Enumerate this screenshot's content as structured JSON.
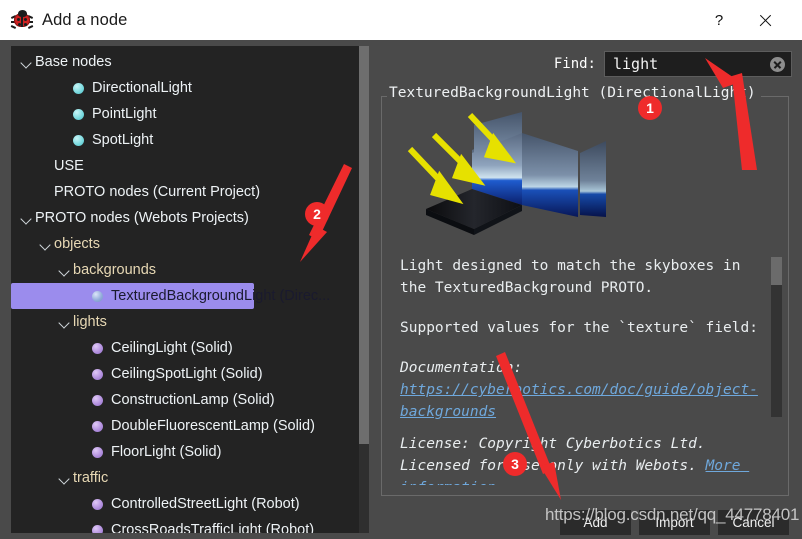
{
  "window": {
    "title": "Add a node",
    "icon": "webots-bug-icon",
    "help_label": "?",
    "close_label": "close-icon"
  },
  "tree": {
    "items": [
      {
        "label": "Base nodes",
        "indent": 0,
        "arrow": "open",
        "bullet": "none",
        "kind": "plain",
        "selected": false
      },
      {
        "label": "DirectionalLight",
        "indent": 2,
        "arrow": "none",
        "bullet": "cyan",
        "kind": "plain",
        "selected": false
      },
      {
        "label": "PointLight",
        "indent": 2,
        "arrow": "none",
        "bullet": "cyan",
        "kind": "plain",
        "selected": false
      },
      {
        "label": "SpotLight",
        "indent": 2,
        "arrow": "none",
        "bullet": "cyan",
        "kind": "plain",
        "selected": false
      },
      {
        "label": "USE",
        "indent": 1,
        "arrow": "none",
        "bullet": "none",
        "kind": "plain",
        "selected": false
      },
      {
        "label": "PROTO nodes (Current Project)",
        "indent": 1,
        "arrow": "none",
        "bullet": "none",
        "kind": "plain",
        "selected": false
      },
      {
        "label": "PROTO nodes (Webots Projects)",
        "indent": 0,
        "arrow": "open",
        "bullet": "none",
        "kind": "plain",
        "selected": false
      },
      {
        "label": "objects",
        "indent": 1,
        "arrow": "open",
        "bullet": "none",
        "kind": "folder",
        "selected": false
      },
      {
        "label": "backgrounds",
        "indent": 2,
        "arrow": "open",
        "bullet": "none",
        "kind": "folder",
        "selected": false
      },
      {
        "label": "TexturedBackgroundLight (Direc...",
        "indent": 3,
        "arrow": "none",
        "bullet": "blue",
        "kind": "plain",
        "selected": true
      },
      {
        "label": "lights",
        "indent": 2,
        "arrow": "open",
        "bullet": "none",
        "kind": "folder",
        "selected": false
      },
      {
        "label": "CeilingLight (Solid)",
        "indent": 3,
        "arrow": "none",
        "bullet": "purple",
        "kind": "plain",
        "selected": false
      },
      {
        "label": "CeilingSpotLight (Solid)",
        "indent": 3,
        "arrow": "none",
        "bullet": "purple",
        "kind": "plain",
        "selected": false
      },
      {
        "label": "ConstructionLamp (Solid)",
        "indent": 3,
        "arrow": "none",
        "bullet": "purple",
        "kind": "plain",
        "selected": false
      },
      {
        "label": "DoubleFluorescentLamp (Solid)",
        "indent": 3,
        "arrow": "none",
        "bullet": "purple",
        "kind": "plain",
        "selected": false
      },
      {
        "label": "FloorLight (Solid)",
        "indent": 3,
        "arrow": "none",
        "bullet": "purple",
        "kind": "plain",
        "selected": false
      },
      {
        "label": "traffic",
        "indent": 2,
        "arrow": "open",
        "bullet": "none",
        "kind": "folder",
        "selected": false
      },
      {
        "label": "ControlledStreetLight (Robot)",
        "indent": 3,
        "arrow": "none",
        "bullet": "purple",
        "kind": "plain",
        "selected": false
      },
      {
        "label": "CrossRoadsTrafficLight (Robot)",
        "indent": 3,
        "arrow": "none",
        "bullet": "purple",
        "kind": "plain",
        "selected": false
      }
    ]
  },
  "find": {
    "label": "Find:",
    "value": "light",
    "placeholder": "",
    "clear_icon": "clear-icon"
  },
  "details": {
    "title": "TexturedBackgroundLight (DirectionalLight)",
    "preview_alt": "skybox-preview-image",
    "paragraph1": "Light designed to match the skyboxes in the TexturedBackground PROTO.",
    "paragraph2": "Supported values for the `texture` field:",
    "documentation_label": "Documentation: ",
    "documentation_link": "https://cyberbotics.com/doc/guide/object-backgrounds",
    "license_text": "License: Copyright Cyberbotics Ltd. Licensed for use only with Webots. ",
    "license_link": "More information"
  },
  "buttons": {
    "add": "Add",
    "import": "Import",
    "cancel": "Cancel"
  },
  "annotations": {
    "badge1": "1",
    "badge2": "2",
    "badge3": "3",
    "watermark": "https://blog.csdn.net/qq_44778401",
    "accent_color": "#ef2b2b"
  }
}
